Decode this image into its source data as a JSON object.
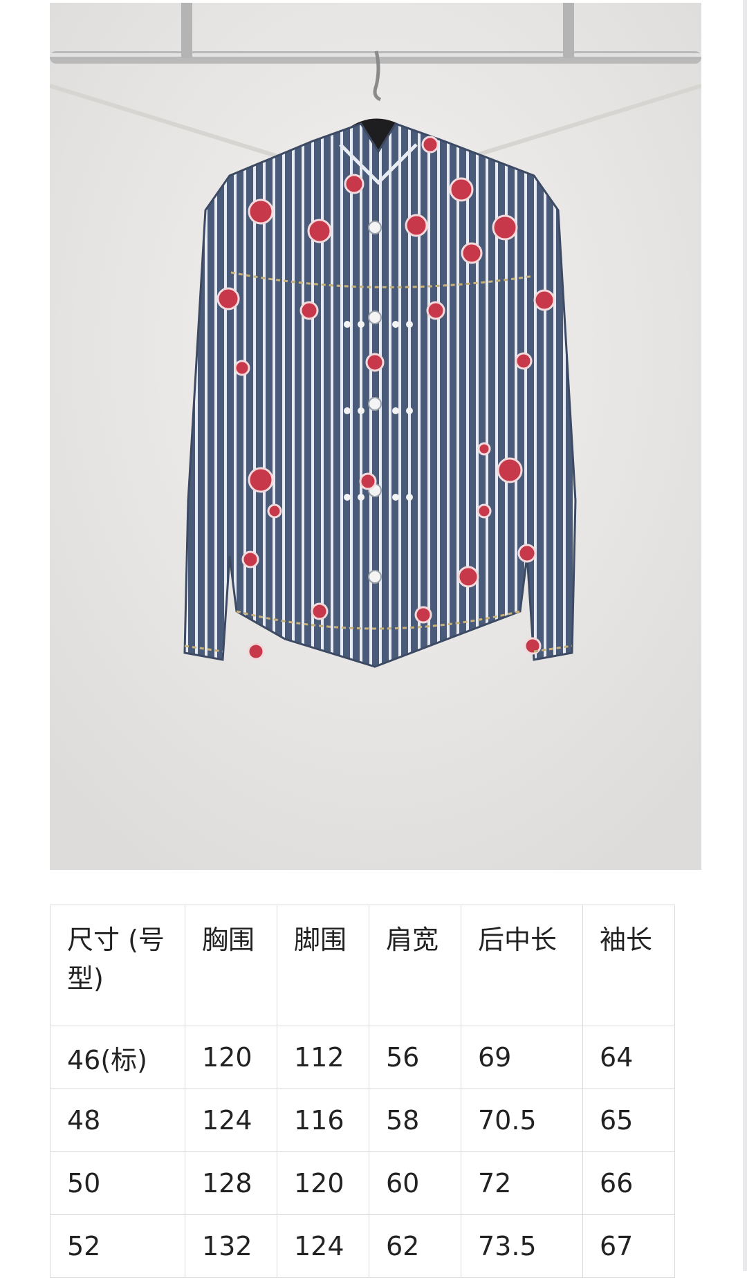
{
  "product_image": {
    "alt": "",
    "colors": {
      "denim": "#4a5b79",
      "stripe": "#e8ecf2",
      "emblem": "#c7394a",
      "backdrop": "#ecebea",
      "rail": "#b9b9b9"
    }
  },
  "size_table": {
    "headers": [
      "尺寸 (号型)",
      "胸围",
      "脚围",
      "肩宽",
      "后中长",
      "袖长"
    ],
    "rows": [
      [
        "46(标)",
        "120",
        "112",
        "56",
        "69",
        "64"
      ],
      [
        "48",
        "124",
        "116",
        "58",
        "70.5",
        "65"
      ],
      [
        "50",
        "128",
        "120",
        "60",
        "72",
        "66"
      ],
      [
        "52",
        "132",
        "124",
        "62",
        "73.5",
        "67"
      ]
    ]
  }
}
